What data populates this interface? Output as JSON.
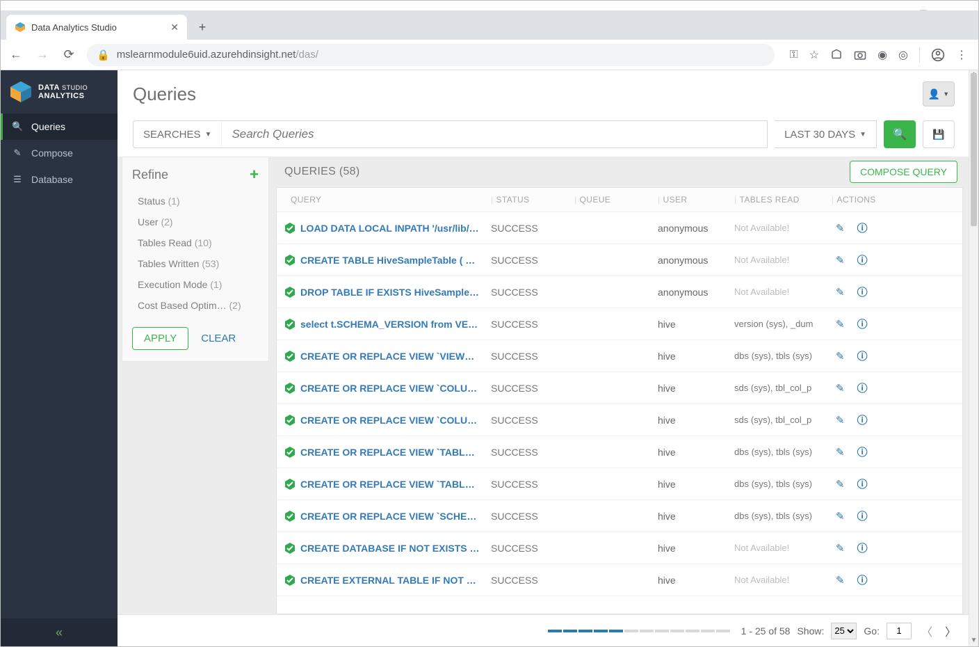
{
  "browser": {
    "tab_title": "Data Analytics Studio",
    "url_host": "mslearnmodule6uid.azurehdinsight.net",
    "url_path": "/das/"
  },
  "brand": {
    "line1": "DATA",
    "line2": "STUDIO",
    "line3": "ANALYTICS"
  },
  "nav": {
    "queries": "Queries",
    "compose": "Compose",
    "database": "Database"
  },
  "page": {
    "title": "Queries"
  },
  "searchbar": {
    "searches_label": "SEARCHES",
    "placeholder": "Search Queries",
    "range_label": "LAST 30 DAYS"
  },
  "refine": {
    "title": "Refine",
    "items": [
      {
        "label": "Status",
        "count": "(1)"
      },
      {
        "label": "User",
        "count": "(2)"
      },
      {
        "label": "Tables Read",
        "count": "(10)"
      },
      {
        "label": "Tables Written",
        "count": "(53)"
      },
      {
        "label": "Execution Mode",
        "count": "(1)"
      },
      {
        "label": "Cost Based Optim…",
        "count": "(2)"
      }
    ],
    "apply": "APPLY",
    "clear": "CLEAR"
  },
  "table": {
    "title": "QUERIES (58)",
    "compose": "COMPOSE QUERY",
    "columns": {
      "query": "QUERY",
      "status": "STATUS",
      "queue": "QUEUE",
      "user": "USER",
      "tables": "TABLES READ",
      "actions": "ACTIONS"
    },
    "rows": [
      {
        "query": "LOAD DATA LOCAL INPATH '/usr/lib/exa…",
        "status": "SUCCESS",
        "user": "anonymous",
        "tables": "Not Available!",
        "na": true
      },
      {
        "query": "CREATE TABLE HiveSampleTable ( Clie…",
        "status": "SUCCESS",
        "user": "anonymous",
        "tables": "Not Available!",
        "na": true
      },
      {
        "query": "DROP TABLE IF EXISTS HiveSampleTa…",
        "status": "SUCCESS",
        "user": "anonymous",
        "tables": "Not Available!",
        "na": true
      },
      {
        "query": "select t.SCHEMA_VERSION from VERS…",
        "status": "SUCCESS",
        "user": "hive",
        "tables": "version (sys), _dum"
      },
      {
        "query": "CREATE OR REPLACE VIEW `VIEWS` …",
        "status": "SUCCESS",
        "user": "hive",
        "tables": "dbs (sys), tbls (sys)"
      },
      {
        "query": "CREATE OR REPLACE VIEW `COLUM…",
        "status": "SUCCESS",
        "user": "hive",
        "tables": "sds (sys), tbl_col_p"
      },
      {
        "query": "CREATE OR REPLACE VIEW `COLUM…",
        "status": "SUCCESS",
        "user": "hive",
        "tables": "sds (sys), tbl_col_p"
      },
      {
        "query": "CREATE OR REPLACE VIEW `TABLE_…",
        "status": "SUCCESS",
        "user": "hive",
        "tables": "dbs (sys), tbls (sys)"
      },
      {
        "query": "CREATE OR REPLACE VIEW `TABLES…",
        "status": "SUCCESS",
        "user": "hive",
        "tables": "dbs (sys), tbls (sys)"
      },
      {
        "query": "CREATE OR REPLACE VIEW `SCHEM…",
        "status": "SUCCESS",
        "user": "hive",
        "tables": "dbs (sys), tbls (sys)"
      },
      {
        "query": "CREATE DATABASE IF NOT EXISTS IN…",
        "status": "SUCCESS",
        "user": "hive",
        "tables": "Not Available!",
        "na": true
      },
      {
        "query": "CREATE EXTERNAL TABLE IF NOT EX…",
        "status": "SUCCESS",
        "user": "hive",
        "tables": "Not Available!",
        "na": true
      }
    ]
  },
  "pager": {
    "range": "1 - 25 of 58",
    "show_label": "Show:",
    "show_value": "25",
    "go_label": "Go:",
    "go_value": "1"
  }
}
